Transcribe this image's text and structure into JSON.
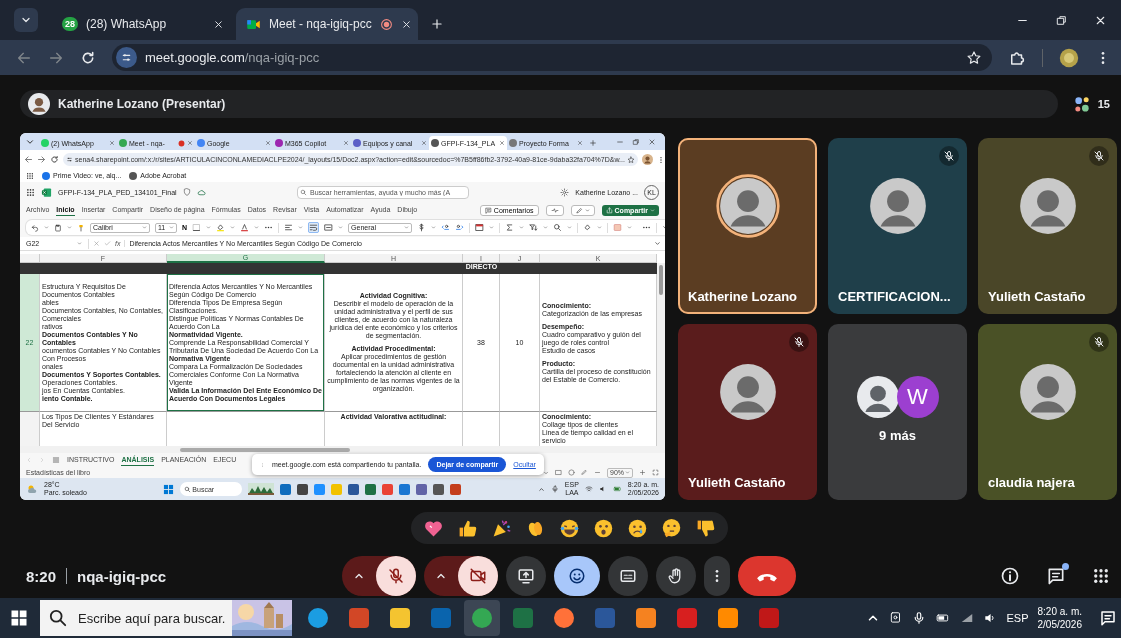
{
  "browser": {
    "tabs": [
      {
        "label": "(28) WhatsApp",
        "badge": "28",
        "recording": false,
        "selected": false
      },
      {
        "label": "Meet - nqa-igiq-pcc",
        "recording": true,
        "selected": true
      }
    ],
    "url_host": "meet.google.com",
    "url_path": "/nqa-igiq-pcc"
  },
  "meet": {
    "presenter": "Katherine Lozano (Presentar)",
    "participant_count": "15",
    "shared_screen": {
      "tabs": [
        {
          "label": "(2) WhatsApp",
          "recording": false,
          "selected": false
        },
        {
          "label": "Meet - nqa-",
          "recording": true,
          "selected": false
        },
        {
          "label": "Google",
          "recording": false,
          "selected": false
        },
        {
          "label": "M365 Copilot",
          "recording": false,
          "selected": false
        },
        {
          "label": "Equipos y canal",
          "recording": false,
          "selected": false
        },
        {
          "label": "GFPI-F-134_PLA",
          "recording": false,
          "selected": true
        },
        {
          "label": "Proyecto Forma",
          "recording": false,
          "selected": false
        }
      ],
      "url": "sena4.sharepoint.com/:x:/r/sites/ARTICULACINCONLAMEDIACLPE2024/_layouts/15/Doc2.aspx?action=edit&sourcedoc=%7B5ff86fb2-3792-40a9-81ce-9daba32fa704%7D&w...",
      "bookmarks": [
        "Prime Video: ve, alq...",
        "Adobe Acrobat"
      ],
      "file_name": "GFPI-F-134_PLA_PED_134101_Final",
      "search_placeholder": "Buscar herramientas, ayuda y mucho más (A",
      "user_name": "Katherine Lozano ...",
      "user_initials": "KL",
      "ribbon_tabs": [
        {
          "label": "Archivo",
          "selected": false
        },
        {
          "label": "Inicio",
          "selected": true
        },
        {
          "label": "Insertar",
          "selected": false
        },
        {
          "label": "Compartir",
          "selected": false
        },
        {
          "label": "Diseño de página",
          "selected": false
        },
        {
          "label": "Fórmulas",
          "selected": false
        },
        {
          "label": "Datos",
          "selected": false
        },
        {
          "label": "Revisar",
          "selected": false
        },
        {
          "label": "Vista",
          "selected": false
        },
        {
          "label": "Automatizar",
          "selected": false
        },
        {
          "label": "Ayuda",
          "selected": false
        },
        {
          "label": "Dibujo",
          "selected": false
        }
      ],
      "comments_button": "Comentarios",
      "share_button": "Compartir",
      "font_name": "Calibri",
      "font_size": "11",
      "bold_label": "N",
      "number_format": "General",
      "cell_ref": "G22",
      "function_label": "fx",
      "formula": "Diferencia Actos Mercantiles Y No Mercantiles Según Código De Comercio",
      "columns": [
        {
          "label": "F",
          "selected": false
        },
        {
          "label": "G",
          "selected": true
        },
        {
          "label": "H",
          "selected": false
        },
        {
          "label": "I",
          "selected": false,
          "header": "DIRECTO"
        },
        {
          "label": "J",
          "selected": false
        },
        {
          "label": "K",
          "selected": false
        }
      ],
      "rows": [
        {
          "number": "22",
          "f": [
            {
              "text": "Estructura Y Requisitos De Documentos Contables",
              "bold": false
            },
            {
              "text": "ables",
              "bold": false
            },
            {
              "text": "Documentos Contables, No Contables, Comerciales",
              "bold": false
            },
            {
              "text": "rativos",
              "bold": false
            },
            {
              "text": "Documentos Contables Y No Contables",
              "bold": true
            },
            {
              "text": "ocumentos Contables Y No Contables Con Procesos",
              "bold": false
            },
            {
              "text": "onales",
              "bold": false
            },
            {
              "text": "Documentos Y Soportes Contables.",
              "bold": true
            },
            {
              "text": "Operaciones Contables.",
              "bold": false
            },
            {
              "text": "jos En Cuentas Contables.",
              "bold": false
            },
            {
              "text": "iento Contable.",
              "bold": true
            }
          ],
          "g": [
            {
              "text": "Diferencia Actos Mercantiles Y No Mercantiles Según Código De Comercio",
              "bold": false
            },
            {
              "text": "Diferencia Tipos De Empresa Según Clasificaciones.",
              "bold": false
            },
            {
              "text": "Distingue Políticas Y Normas Contables De Acuerdo Con La",
              "bold": false
            },
            {
              "text": "Normatividad Vigente.",
              "bold": true
            },
            {
              "text": "Comprende La Responsabilidad Comercial Y Tributaria De Una Sociedad De Acuerdo Con La",
              "bold": false
            },
            {
              "text": "Normativa Vigente",
              "bold": true
            },
            {
              "text": "Compara La Formalización De Sociedades Comerciales Conforme Con La Normativa Vigente",
              "bold": false
            },
            {
              "text": "Valida La Información Del Ente Económico De Acuerdo Con Documentos Legales",
              "bold": true
            }
          ],
          "h": [
            {
              "kind": "heading",
              "text": "Actividad Cognitiva:"
            },
            {
              "kind": "text",
              "text": "Describir el modelo de operación de la unidad administrativa y el perfil de sus clientes, de acuerdo con la naturaleza jurídica del ente económico y los criterios de segmentación."
            },
            {
              "kind": "heading",
              "text": "Actividad Procedimental:"
            },
            {
              "kind": "text",
              "text": "Aplicar procedimientos de gestión documental en la unidad administrativa fortaleciendo la atención al cliente en cumplimiento de las normas vigentes de la organización."
            }
          ],
          "i": "38",
          "j": "10",
          "k": [
            {
              "kind": "heading",
              "text": "Conocimiento:"
            },
            {
              "kind": "text",
              "text": "Categorización de las empresas"
            },
            {
              "kind": "heading",
              "text": "Desempeño:"
            },
            {
              "kind": "text",
              "text": "Cuadro comparativo y guión del juego de roles control"
            },
            {
              "kind": "text",
              "text": "Estudio de casos"
            },
            {
              "kind": "heading",
              "text": "Producto:"
            },
            {
              "kind": "text",
              "text": "Cartilla del proceso de constitución del Estable de Comercio."
            }
          ]
        },
        {
          "f": [
            {
              "text": "Los Tipos De Clientes Y Estándares Del Servicio",
              "bold": false
            }
          ],
          "h": [
            {
              "kind": "heading",
              "text": "Actividad Valorativa actitudinal:"
            }
          ],
          "k": [
            {
              "kind": "heading",
              "text": "Conocimiento:"
            },
            {
              "kind": "text",
              "text": "Collage tipos de clientes"
            },
            {
              "kind": "text",
              "text": "Linea de tiempo calidad en el servicio"
            }
          ]
        }
      ],
      "sheet_tabs": [
        {
          "label": "INSTRUCTIVO",
          "selected": false
        },
        {
          "label": "ANÁLISIS",
          "selected": true
        },
        {
          "label": "PLANEACIÓN",
          "selected": false
        },
        {
          "label": "EJECU",
          "selected": false
        }
      ],
      "share_notice": "meet.google.com está compartiendo tu pantalla.",
      "stop_share_button": "Dejar de compartir",
      "hide_link": "Ocultar",
      "status_text": "Estadísticas del libro",
      "zoom": "90%",
      "taskbar": {
        "temperature": "28°C",
        "weather": "Parc. soleado",
        "search_placeholder": "Buscar",
        "language": "ESP",
        "layout": "LAA",
        "time": "8:20 a. m.",
        "date": "2/05/2026"
      }
    },
    "tiles": [
      {
        "kind": "person",
        "name": "Katherine Lozano",
        "color": "#5b3d22",
        "muted": false,
        "speaking": true
      },
      {
        "kind": "person",
        "name": "CERTIFICACION...",
        "color": "#1f3f4a",
        "muted": true,
        "speaking": false
      },
      {
        "kind": "person",
        "name": "Yulieth Castaño",
        "color": "#4a4628",
        "muted": true,
        "speaking": false
      },
      {
        "kind": "person",
        "name": "Yulieth Castaño",
        "color": "#5a1c1c",
        "muted": true,
        "speaking": false
      },
      {
        "kind": "group",
        "label": "9 más",
        "initial": "W",
        "color": "#3a3b3d",
        "muted": false,
        "speaking": false
      },
      {
        "kind": "person",
        "name": "claudia najera",
        "color": "#4a5126",
        "muted": true,
        "speaking": false
      }
    ],
    "meeting_time": "8:20",
    "meeting_code": "nqa-igiq-pcc",
    "controls": {
      "mic_muted": true,
      "camera_off": true,
      "reactions_selected": true,
      "captions_on": false,
      "hand_raised": false
    },
    "chat_unread": true
  },
  "taskbar": {
    "search_placeholder": "Escribe aquí para buscar.",
    "language": "ESP",
    "time": "8:20 a. m.",
    "date": "2/05/2026"
  }
}
